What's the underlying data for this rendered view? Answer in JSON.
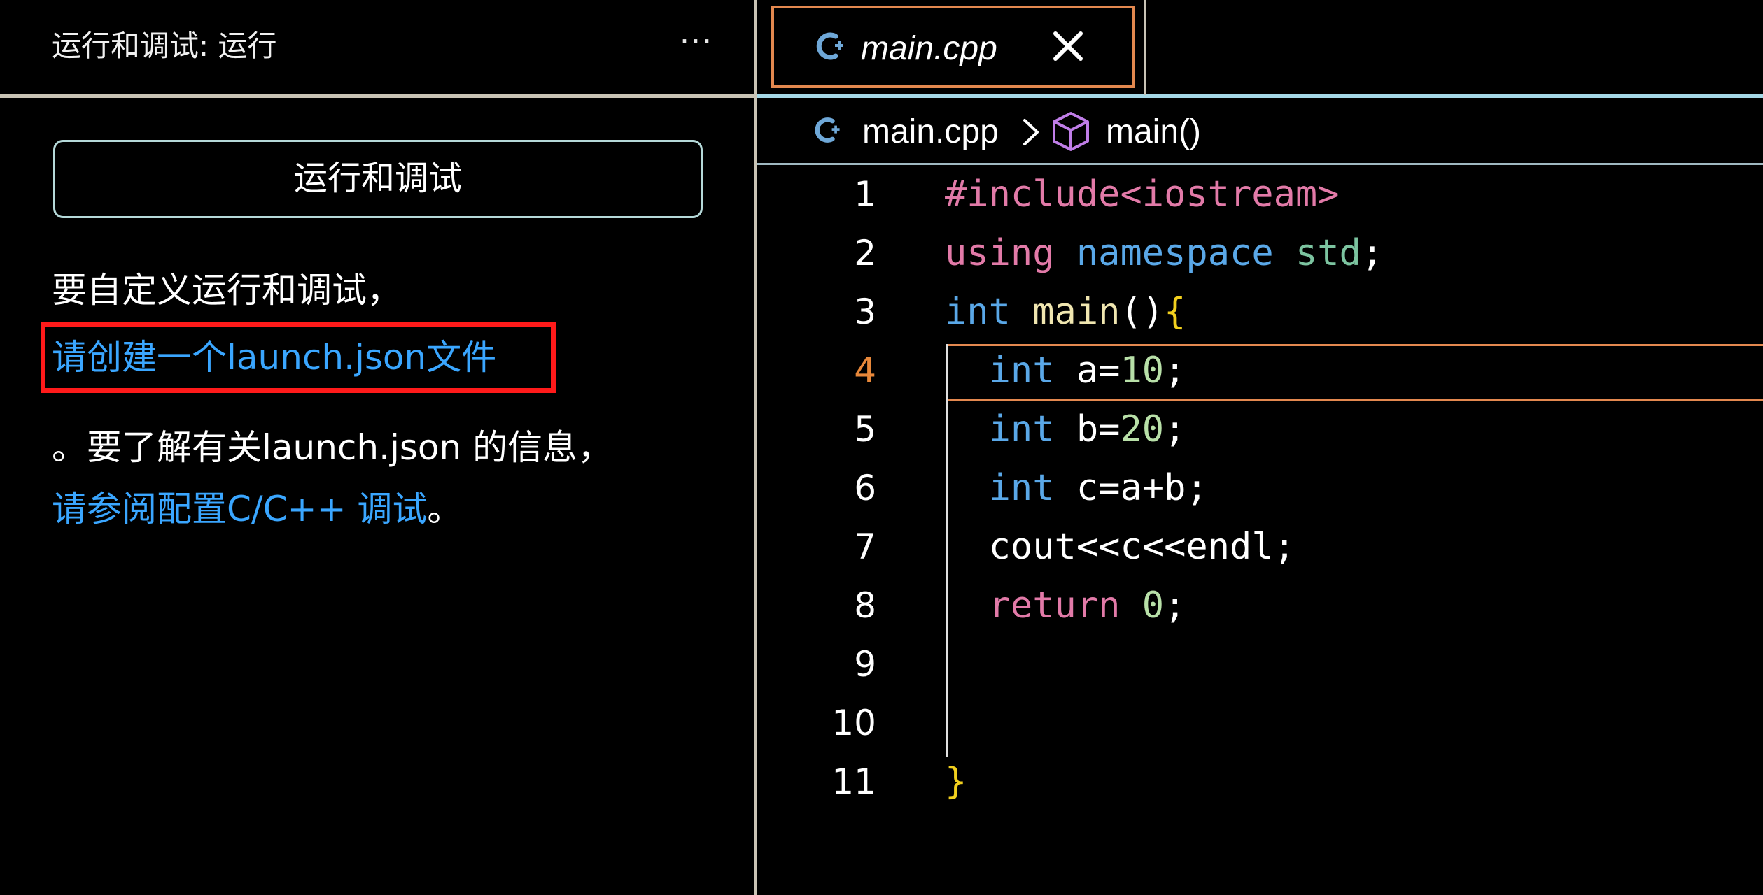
{
  "sidebar": {
    "title": "运行和调试: 运行",
    "more_label": "···",
    "run_button_label": "运行和调试",
    "help_line_1": "要自定义运行和调试，",
    "create_link": "请创建一个launch.json文件",
    "help_line_3": "。要了解有关launch.json 的信息，",
    "docs_link": "请参阅配置C/C++ 调试",
    "docs_suffix": "。"
  },
  "tabs": [
    {
      "label": "main.cpp",
      "active": true,
      "icon": "cpp-file-icon"
    }
  ],
  "breadcrumb": {
    "file": "main.cpp",
    "symbol": "main()",
    "file_icon": "cpp-file-icon",
    "symbol_icon": "cube-icon"
  },
  "editor": {
    "current_line": 4,
    "line_numbers": [
      "1",
      "2",
      "3",
      "4",
      "5",
      "6",
      "7",
      "8",
      "9",
      "10",
      "11"
    ],
    "lines": [
      "#include<iostream>",
      "using namespace std;",
      "int main(){",
      "  int a=10;",
      "  int b=20;",
      "  int c=a+b;",
      "  cout<<c<<endl;",
      "  return 0;",
      "",
      "",
      "}"
    ]
  },
  "colors": {
    "link": "#3aa6ff",
    "highlight_box": "#ff1a1a",
    "active_tab_border": "#e3884f",
    "current_line_number": "#e8883a",
    "keyword_blue": "#5aa8e8",
    "keyword_pink": "#e27aa8",
    "namespace_green": "#7cc4a0",
    "number": "#b8e0a8",
    "brace_yellow": "#f2d01e"
  }
}
